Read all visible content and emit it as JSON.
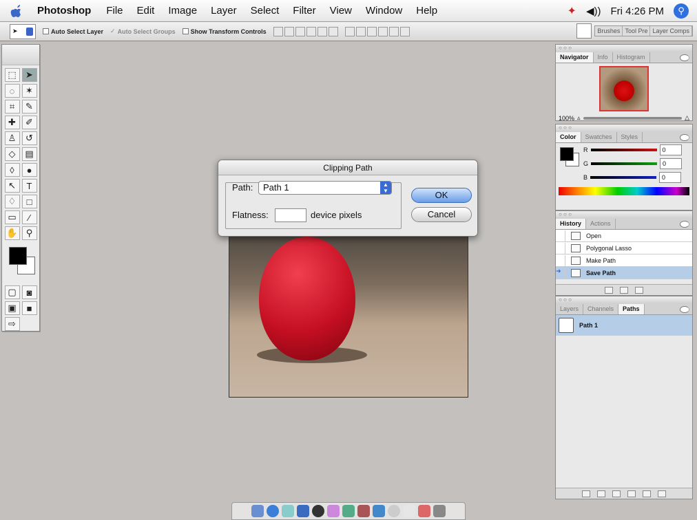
{
  "menubar": {
    "app": "Photoshop",
    "items": [
      "File",
      "Edit",
      "Image",
      "Layer",
      "Select",
      "Filter",
      "View",
      "Window",
      "Help"
    ],
    "clock": "Fri 4:26 PM",
    "volume_icon": "speaker-icon",
    "spotlight_icon": "spotlight-icon"
  },
  "options": {
    "auto_select_layer": "Auto Select Layer",
    "auto_select_groups": "Auto Select Groups",
    "show_transform": "Show Transform Controls",
    "palette_tabs": [
      "Brushes",
      "Tool Pre",
      "Layer Comps"
    ]
  },
  "dialog": {
    "title": "Clipping Path",
    "path_label": "Path:",
    "path_value": "Path 1",
    "flatness_label": "Flatness:",
    "flatness_value": "",
    "flatness_unit": "device pixels",
    "ok": "OK",
    "cancel": "Cancel"
  },
  "navigator": {
    "tabs": [
      "Navigator",
      "Info",
      "Histogram"
    ],
    "zoom": "100%"
  },
  "color": {
    "tabs": [
      "Color",
      "Swatches",
      "Styles"
    ],
    "channels": [
      {
        "name": "R",
        "value": "0",
        "color": "#d01010"
      },
      {
        "name": "G",
        "value": "0",
        "color": "#10a010"
      },
      {
        "name": "B",
        "value": "0",
        "color": "#1020c0"
      }
    ]
  },
  "history": {
    "tabs": [
      "History",
      "Actions"
    ],
    "items": [
      "Open",
      "Polygonal Lasso",
      "Make Path",
      "Save Path"
    ]
  },
  "paths": {
    "tabs": [
      "Layers",
      "Channels",
      "Paths"
    ],
    "items": [
      "Path 1"
    ]
  }
}
